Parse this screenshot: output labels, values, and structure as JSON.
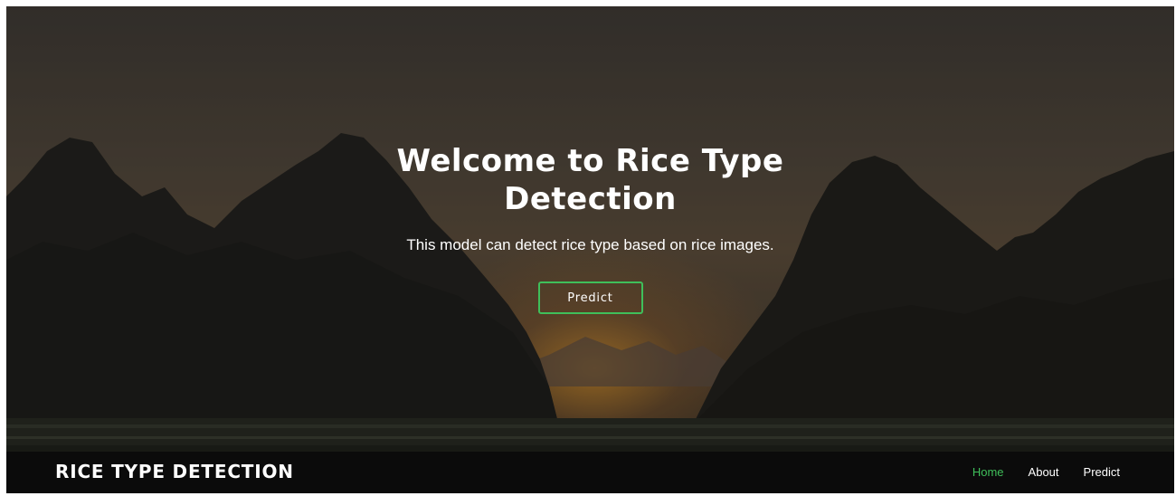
{
  "hero": {
    "title": "Welcome to Rice Type Detection",
    "subtitle": "This model can detect rice type based on rice images.",
    "cta_label": "Predict",
    "background_image": "sunset-mountains-landscape"
  },
  "navbar": {
    "brand": "RICE TYPE DETECTION",
    "links": [
      {
        "label": "Home",
        "active": true
      },
      {
        "label": "About",
        "active": false
      },
      {
        "label": "Predict",
        "active": false
      }
    ]
  },
  "colors": {
    "accent": "#3fbf5a",
    "navbar_bg": "#0b0b0b",
    "text": "#ffffff"
  }
}
